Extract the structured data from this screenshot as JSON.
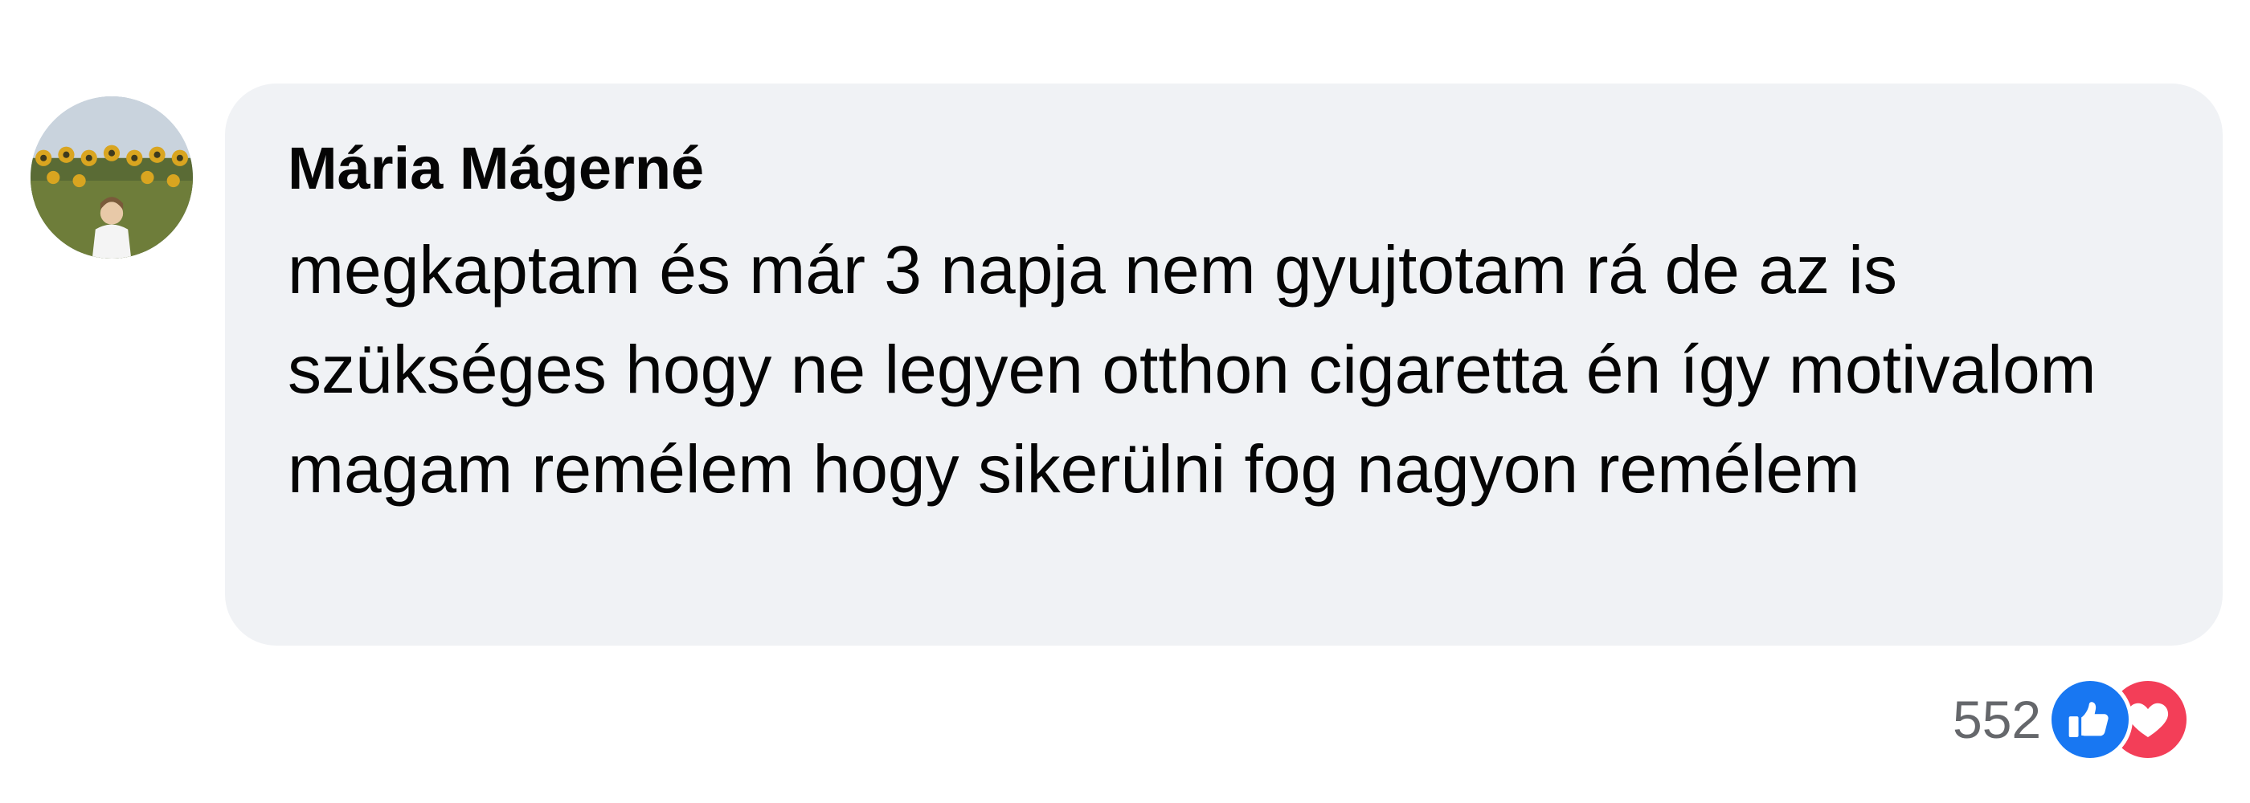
{
  "comment": {
    "author": "Mária Mágerné",
    "text": "megkaptam és már 3 napja nem gyujtotam rá de az is szükséges hogy ne legyen otthon cigaretta én így motivalom magam remélem hogy sikerülni fog nagyon remélem",
    "avatar": {
      "icon": "profile-photo-sunflower-field"
    },
    "reactions": {
      "count": "552",
      "types": [
        {
          "icon": "like-icon",
          "color": "#1877f2"
        },
        {
          "icon": "love-icon",
          "color": "#f33e58"
        }
      ]
    }
  },
  "colors": {
    "bubble": "#f0f2f5",
    "text": "#050505",
    "secondary_text": "#65676b"
  }
}
